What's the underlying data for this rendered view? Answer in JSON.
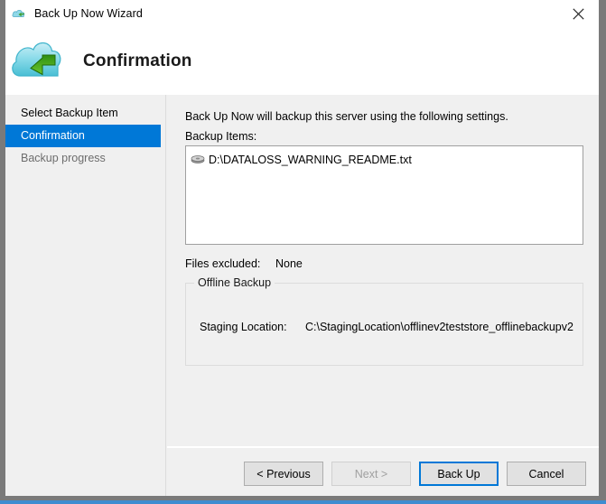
{
  "window": {
    "title": "Back Up Now Wizard",
    "title_icon": "cloud-backup-icon",
    "close_icon": "close-icon"
  },
  "header": {
    "icon": "cloud-restore-icon",
    "title": "Confirmation"
  },
  "sidebar": {
    "items": [
      {
        "label": "Select Backup Item",
        "state": "done"
      },
      {
        "label": "Confirmation",
        "state": "active"
      },
      {
        "label": "Backup progress",
        "state": "future"
      }
    ]
  },
  "content": {
    "intro": "Back Up Now will backup this server using the following settings.",
    "items_label": "Backup Items:",
    "backup_items": [
      {
        "icon": "disk-icon",
        "path": "D:\\DATALOSS_WARNING_README.txt"
      }
    ],
    "excluded_label": "Files excluded:",
    "excluded_value": "None",
    "group_legend": "Offline Backup",
    "staging_label": "Staging Location:",
    "staging_value": "C:\\StagingLocation\\offlinev2teststore_offlinebackupv2"
  },
  "footer": {
    "previous": "< Previous",
    "next": "Next >",
    "backup": "Back Up",
    "cancel": "Cancel"
  },
  "colors": {
    "accent": "#0078d7",
    "window_bg": "#f0f0f0",
    "titlebar_bg": "#ffffff",
    "border": "#7a7a7a",
    "taskbar_blue": "#3f8cd0"
  }
}
